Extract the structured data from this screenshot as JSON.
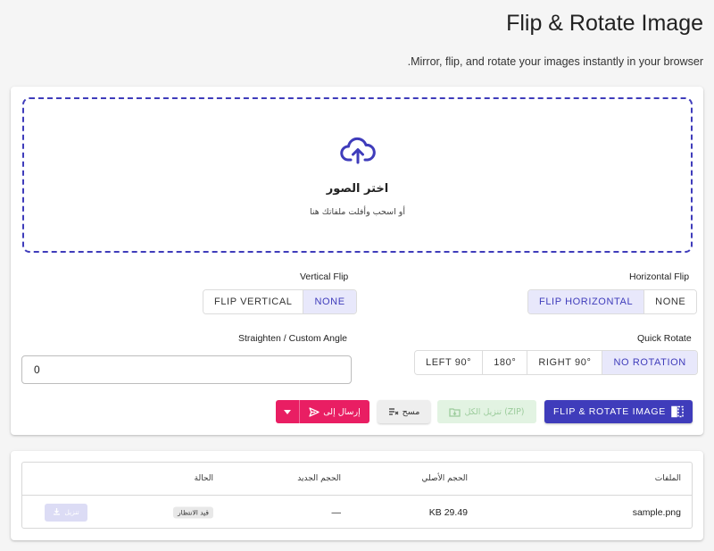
{
  "header": {
    "title": "Flip & Rotate Image",
    "subtitle": ".Mirror, flip, and rotate your images instantly in your browser"
  },
  "dropzone": {
    "title": "اختر الصور",
    "hint": "أو اسحب وأفلت ملفاتك هنا",
    "icon": "cloud-upload-icon"
  },
  "horizontal_flip": {
    "label": "Horizontal Flip",
    "options": [
      "FLIP HORIZONTAL",
      "NONE"
    ],
    "selected": "FLIP HORIZONTAL"
  },
  "vertical_flip": {
    "label": "Vertical Flip",
    "options": [
      "FLIP VERTICAL",
      "NONE"
    ],
    "selected": "NONE"
  },
  "quick_rotate": {
    "label": "Quick Rotate",
    "options": [
      "LEFT 90°",
      "180°",
      "RIGHT 90°",
      "NO ROTATION"
    ],
    "selected": "NO ROTATION"
  },
  "custom_angle": {
    "label": "Straighten / Custom Angle",
    "value": "0"
  },
  "actions": {
    "primary": "FLIP & ROTATE IMAGE",
    "download_zip": "تنزيل الكل (ZIP)",
    "clear": "مسح",
    "send_to": "إرسال إلى"
  },
  "table": {
    "headers": {
      "files": "الملفات",
      "original_size": "الحجم الأصلي",
      "new_size": "الحجم الجديد",
      "status": "الحالة"
    },
    "rows": [
      {
        "file": "sample.png",
        "original_size": "KB 29.49",
        "new_size": "—",
        "status": "قيد الانتظار",
        "download": "تنزيل"
      }
    ]
  },
  "colors": {
    "accent": "#3f3cbb",
    "accent_light": "#e8e8fb",
    "send": "#e91e63",
    "zip_disabled": "#e2f3e2"
  }
}
